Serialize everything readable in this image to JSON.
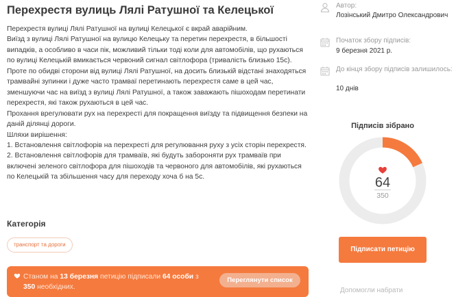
{
  "petition": {
    "title": "Перехрестя вулиць Лялі Ратушної та Келецької",
    "paragraphs": [
      "Перехрестя вулиці Лялі Ратушної на вулиці Келецької є вкрай аварійним.",
      "Виїзд з вулиці Лялі Ратушної на вулицю Келецьку та перетин перехрестя, в більшості випадків, а особливо в часи пік, можливий тільки тоді коли для автомобілів, що рухаються по вулиці Келецькій вмикається червоний сигнал світлофора (тривалість близько 15с). Проте по обидві сторони від вулиці Лялі Ратушної, на досить близькій відстані знаходяться трамвайні зупинки і дуже часто трамваї перетинають перехрестя саме в цей час, зменшуючи час на виїзд з вулиці Лялі Ратушної, а також заважають пішоходам перетинати перехрестя, які також рухаються в цей час.",
      "Прохання врегулювати рух на перехресті для покращення виїзду та підвищення безпеки на даній ділянці дороги.",
      "Шляхи вирішення:",
      "1. Встановлення світлофорів на перехресті для регулювання руху з усіх сторін перехрестя.",
      "2. Встановлення світлофорів для трамваїв, які будуть забороняти рух трамваїв при включені зеленого світлофора для пішоходів та червоного для автомобілів, які рухаються по Келецькій та збільшення часу для переходу хоча б на 5с."
    ]
  },
  "category": {
    "heading": "Категорія",
    "tag": "транспорт та дороги"
  },
  "banner": {
    "prefix": "Станом на",
    "date": "13 березня",
    "middle": "петицію підписали",
    "count": "64 особи",
    "connector": "з",
    "needed": "350",
    "suffix": "необхідних.",
    "button": "Переглянути список"
  },
  "sidebar": {
    "author_label": "Автор:",
    "author_name": "Лозінський Дмитро Олександрович",
    "start_label": "Початок збору підписів:",
    "start_date": "9 березня 2021 р.",
    "end_label": "До кінця збору підписів залишилось:",
    "end_value": "10 днів",
    "signatures_title": "Підписів зібрано",
    "signed": "64",
    "goal": "350",
    "sign_button": "Підписати петицію",
    "helpers_text": "Допомогли набрати"
  },
  "progress": {
    "signed": 64,
    "goal": 350
  },
  "colors": {
    "accent": "#f57a3e",
    "track": "#ececec",
    "heart": "#e8403a"
  }
}
